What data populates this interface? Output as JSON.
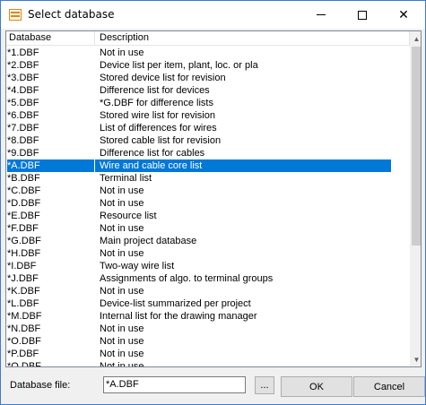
{
  "window": {
    "title": "Select database"
  },
  "list": {
    "columns": [
      "Database",
      "Description"
    ],
    "selected_index": 9,
    "rows": [
      {
        "database": "*1.DBF",
        "description": "Not in use"
      },
      {
        "database": "*2.DBF",
        "description": "Device list per item, plant, loc. or pla"
      },
      {
        "database": "*3.DBF",
        "description": "Stored device list for revision"
      },
      {
        "database": "*4.DBF",
        "description": "Difference list for devices"
      },
      {
        "database": "*5.DBF",
        "description": "*G.DBF for difference lists"
      },
      {
        "database": "*6.DBF",
        "description": "Stored wire list for revision"
      },
      {
        "database": "*7.DBF",
        "description": "List of differences for wires"
      },
      {
        "database": "*8.DBF",
        "description": "Stored cable list for revision"
      },
      {
        "database": "*9.DBF",
        "description": "Difference list for cables"
      },
      {
        "database": "*A.DBF",
        "description": "Wire and cable core list"
      },
      {
        "database": "*B.DBF",
        "description": "Terminal list"
      },
      {
        "database": "*C.DBF",
        "description": "Not in use"
      },
      {
        "database": "*D.DBF",
        "description": "Not in use"
      },
      {
        "database": "*E.DBF",
        "description": "Resource list"
      },
      {
        "database": "*F.DBF",
        "description": "Not in use"
      },
      {
        "database": "*G.DBF",
        "description": "Main project database"
      },
      {
        "database": "*H.DBF",
        "description": "Not in use"
      },
      {
        "database": "*I.DBF",
        "description": "Two-way wire list"
      },
      {
        "database": "*J.DBF",
        "description": "Assignments of algo. to terminal groups"
      },
      {
        "database": "*K.DBF",
        "description": "Not in use"
      },
      {
        "database": "*L.DBF",
        "description": "Device-list summarized per project"
      },
      {
        "database": "*M.DBF",
        "description": "Internal list for the drawing manager"
      },
      {
        "database": "*N.DBF",
        "description": "Not in use"
      },
      {
        "database": "*O.DBF",
        "description": "Not in use"
      },
      {
        "database": "*P.DBF",
        "description": "Not in use"
      },
      {
        "database": "*Q.DBF",
        "description": "Not in use"
      }
    ]
  },
  "footer": {
    "label": "Database file:",
    "value": "*A.DBF",
    "browse_label": "...",
    "ok_label": "OK",
    "cancel_label": "Cancel"
  },
  "colors": {
    "selection": "#0078d7",
    "window_border": "#3a7bd5"
  },
  "icons": {
    "app": "database-app-icon",
    "minimize": "minimize-icon",
    "maximize": "maximize-icon",
    "close": "close-icon"
  }
}
